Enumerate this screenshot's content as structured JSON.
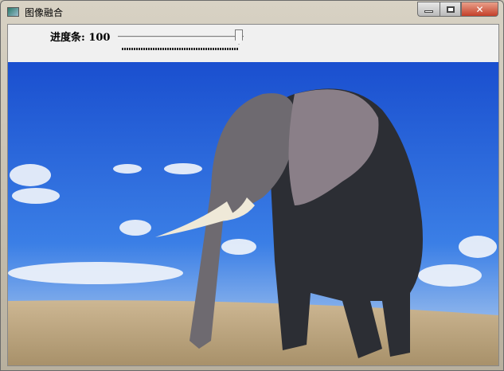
{
  "window": {
    "title": "图像融合",
    "icon": "app-window-icon",
    "controls": {
      "minimize": "minimize-icon",
      "maximize": "maximize-icon",
      "close": "close-icon"
    }
  },
  "trackbar": {
    "label": "进度条:",
    "value": "100",
    "min": 0,
    "max": 100,
    "fraction": 1.0
  },
  "image": {
    "subject": "elephant"
  },
  "colors": {
    "sky": "#1e5fd6",
    "ground": "#c9b28a",
    "close": "#c4402a"
  }
}
